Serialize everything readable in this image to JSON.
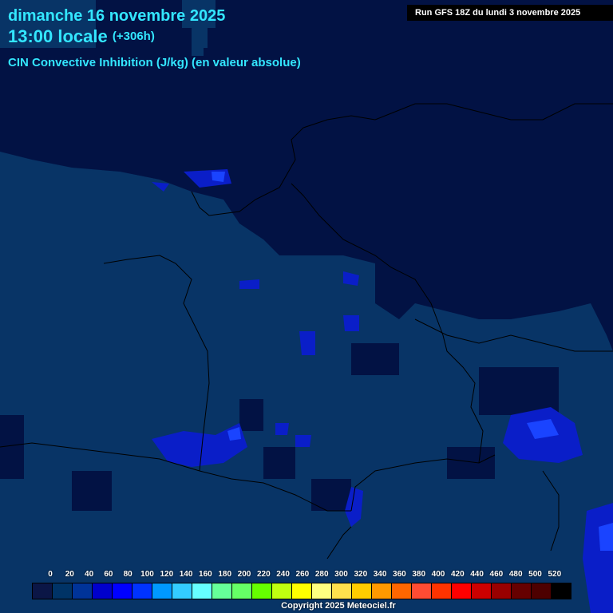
{
  "header": {
    "date": "dimanche 16 novembre 2025",
    "time": "13:00 locale",
    "offset": "(+306h)",
    "parameter": "CIN Convective Inhibition (J/kg) (en valeur absolue)",
    "run": "Run GFS 18Z du lundi 3 novembre 2025"
  },
  "legend": {
    "labels": [
      "0",
      "20",
      "40",
      "60",
      "80",
      "100",
      "120",
      "140",
      "160",
      "180",
      "200",
      "220",
      "240",
      "260",
      "280",
      "300",
      "320",
      "340",
      "360",
      "380",
      "400",
      "420",
      "440",
      "460",
      "480",
      "500",
      "520"
    ],
    "colors": [
      "#0b1646",
      "#003366",
      "#003399",
      "#0000cc",
      "#0000ff",
      "#0033ff",
      "#0099ff",
      "#33ccff",
      "#66ffff",
      "#66ff99",
      "#66ff66",
      "#66ff00",
      "#c0ff10",
      "#ffff00",
      "#ffff80",
      "#ffe04d",
      "#ffcc00",
      "#ff9900",
      "#ff6600",
      "#ff4c33",
      "#ff3300",
      "#ff0000",
      "#cc0000",
      "#990000",
      "#660000",
      "#4d0000",
      "#000000"
    ]
  },
  "footer": {
    "copyright": "Copyright 2025 Meteociel.fr"
  }
}
